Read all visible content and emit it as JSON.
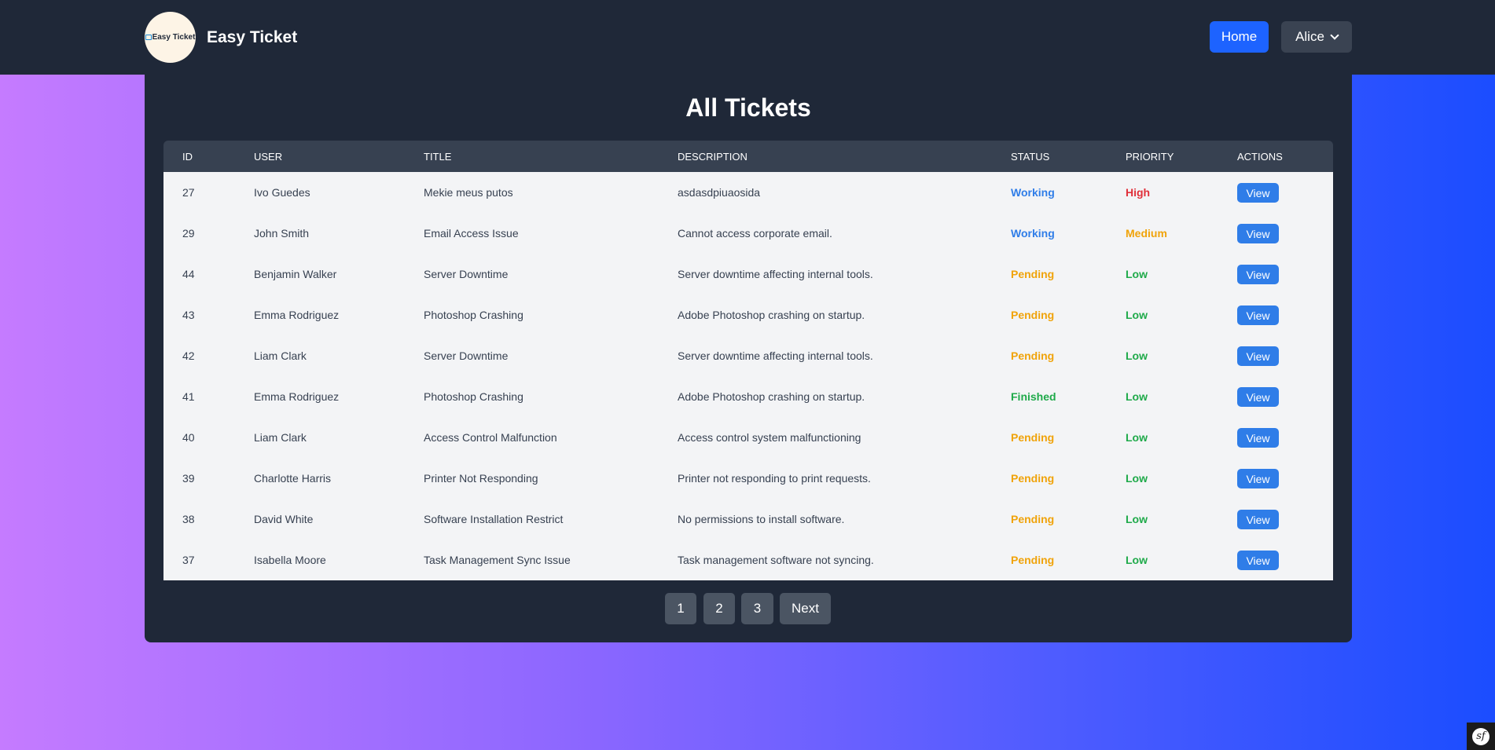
{
  "navbar": {
    "logo_text": "Easy Ticket",
    "brand": "Easy Ticket",
    "home_label": "Home",
    "user_label": "Alice"
  },
  "main": {
    "title": "All Tickets"
  },
  "table": {
    "columns": [
      "ID",
      "USER",
      "TITLE",
      "DESCRIPTION",
      "STATUS",
      "PRIORITY",
      "ACTIONS"
    ],
    "rows": [
      {
        "id": "27",
        "user": "Ivo Guedes",
        "title": "Mekie meus putos",
        "description": "asdasdpiuaosida",
        "status": "Working",
        "priority": "High",
        "action": "View"
      },
      {
        "id": "29",
        "user": "John Smith",
        "title": "Email Access Issue",
        "description": "Cannot access corporate email.",
        "status": "Working",
        "priority": "Medium",
        "action": "View"
      },
      {
        "id": "44",
        "user": "Benjamin Walker",
        "title": "Server Downtime",
        "description": "Server downtime affecting internal tools.",
        "status": "Pending",
        "priority": "Low",
        "action": "View"
      },
      {
        "id": "43",
        "user": "Emma Rodriguez",
        "title": "Photoshop Crashing",
        "description": "Adobe Photoshop crashing on startup.",
        "status": "Pending",
        "priority": "Low",
        "action": "View"
      },
      {
        "id": "42",
        "user": "Liam Clark",
        "title": "Server Downtime",
        "description": "Server downtime affecting internal tools.",
        "status": "Pending",
        "priority": "Low",
        "action": "View"
      },
      {
        "id": "41",
        "user": "Emma Rodriguez",
        "title": "Photoshop Crashing",
        "description": "Adobe Photoshop crashing on startup.",
        "status": "Finished",
        "priority": "Low",
        "action": "View"
      },
      {
        "id": "40",
        "user": "Liam Clark",
        "title": "Access Control Malfunction",
        "description": "Access control system malfunctioning",
        "status": "Pending",
        "priority": "Low",
        "action": "View"
      },
      {
        "id": "39",
        "user": "Charlotte Harris",
        "title": "Printer Not Responding",
        "description": "Printer not responding to print requests.",
        "status": "Pending",
        "priority": "Low",
        "action": "View"
      },
      {
        "id": "38",
        "user": "David White",
        "title": "Software Installation Restrict",
        "description": "No permissions to install software.",
        "status": "Pending",
        "priority": "Low",
        "action": "View"
      },
      {
        "id": "37",
        "user": "Isabella Moore",
        "title": "Task Management Sync Issue",
        "description": "Task management software not syncing.",
        "status": "Pending",
        "priority": "Low",
        "action": "View"
      }
    ]
  },
  "status_colors": {
    "Working": "#2f7de8",
    "Pending": "#f0a30a",
    "Finished": "#1faa4a"
  },
  "priority_colors": {
    "High": "#e0303a",
    "Medium": "#f0a30a",
    "Low": "#1faa4a"
  },
  "pagination": {
    "pages": [
      "1",
      "2",
      "3"
    ],
    "next_label": "Next"
  },
  "debug_toolbar": {
    "icon": "symfony-icon",
    "label": "sf"
  }
}
